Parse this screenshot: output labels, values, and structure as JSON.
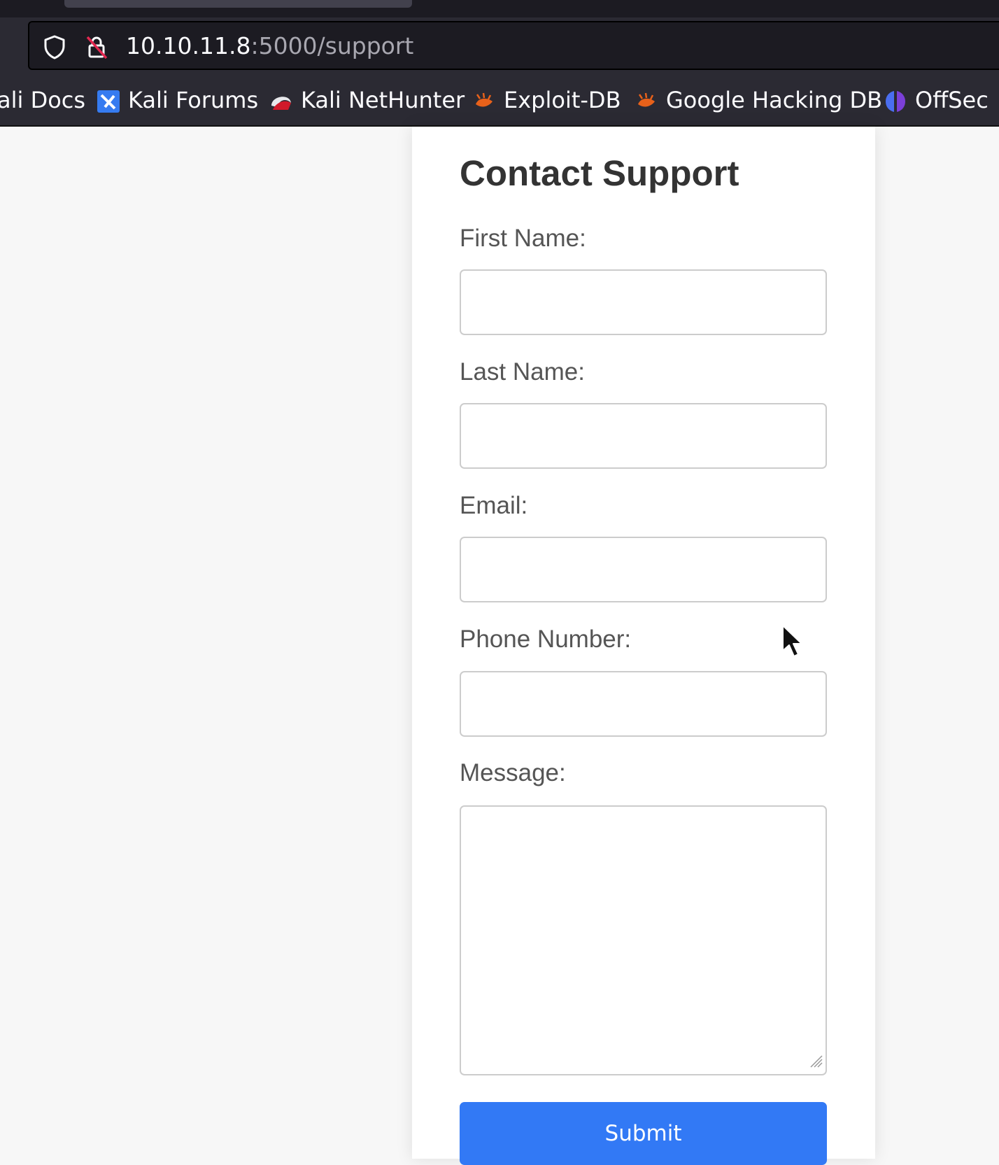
{
  "browser": {
    "url_host": "10.10.11.8",
    "url_rest": ":5000/support",
    "bookmarks": [
      {
        "label": "ali Docs",
        "icon": "none"
      },
      {
        "label": "Kali Forums",
        "icon": "kali-forums-icon"
      },
      {
        "label": "Kali NetHunter",
        "icon": "kali-nethunter-icon"
      },
      {
        "label": "Exploit-DB",
        "icon": "exploit-db-icon"
      },
      {
        "label": "Google Hacking DB",
        "icon": "exploit-db-icon"
      },
      {
        "label": "OffSec",
        "icon": "offsec-icon"
      }
    ]
  },
  "form": {
    "title": "Contact Support",
    "fields": [
      {
        "label": "First Name:",
        "value": ""
      },
      {
        "label": "Last Name:",
        "value": ""
      },
      {
        "label": "Email:",
        "value": ""
      },
      {
        "label": "Phone Number:",
        "value": ""
      },
      {
        "label": "Message:",
        "value": ""
      }
    ],
    "submit_label": "Submit"
  },
  "colors": {
    "accent": "#3279f5",
    "page_background": "#f7f7f7",
    "chrome_dark": "#1c1b22",
    "chrome": "#2b2a33"
  }
}
